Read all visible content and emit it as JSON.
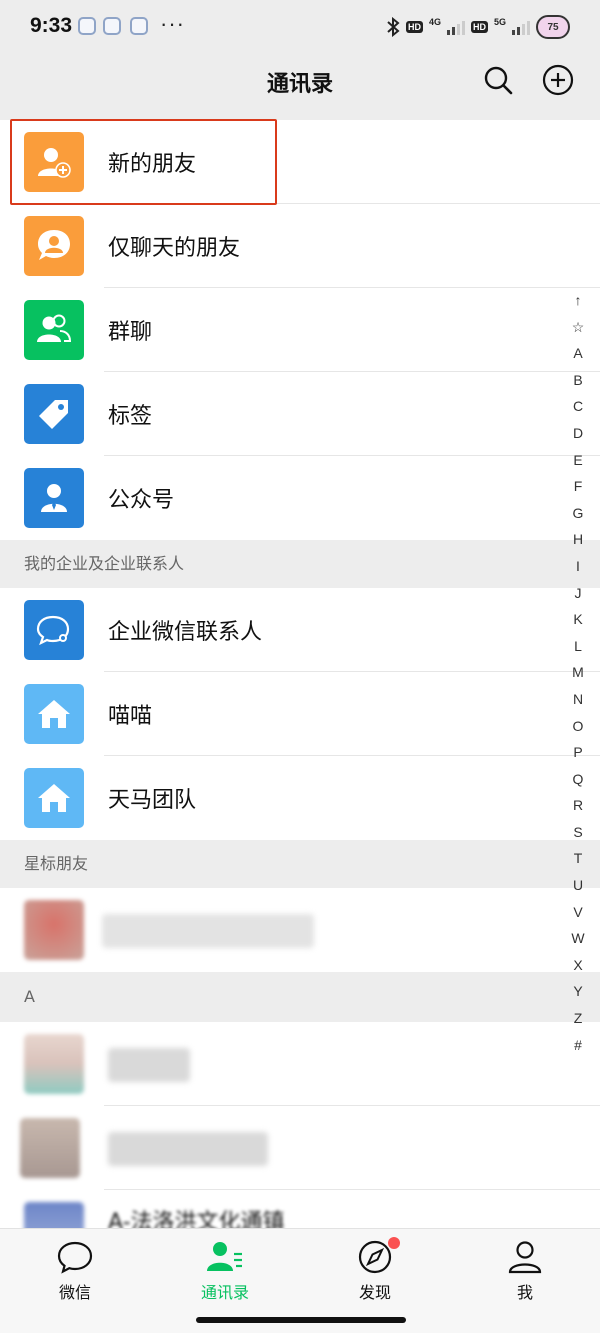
{
  "status_bar": {
    "time": "9:33",
    "dots": "···",
    "net1": "4G",
    "net2": "5G",
    "hd1": "HD",
    "hd2": "HD",
    "battery": "75"
  },
  "header": {
    "title": "通讯录",
    "search_icon": "search-icon",
    "add_icon": "plus-circle-icon"
  },
  "top_items": [
    {
      "label": "新的朋友",
      "icon": "add-friend-icon",
      "color": "#fa9d3b"
    },
    {
      "label": "仅聊天的朋友",
      "icon": "chat-only-icon",
      "color": "#fa9d3b"
    },
    {
      "label": "群聊",
      "icon": "group-icon",
      "color": "#07c160"
    },
    {
      "label": "标签",
      "icon": "tag-icon",
      "color": "#2782d7"
    },
    {
      "label": "公众号",
      "icon": "official-account-icon",
      "color": "#2782d7"
    }
  ],
  "enterprise": {
    "header": "我的企业及企业联系人",
    "items": [
      {
        "label": "企业微信联系人",
        "icon": "wecom-icon",
        "color": "#2782d7"
      },
      {
        "label": "喵喵",
        "icon": "house-icon",
        "color": "#5fb8f5"
      },
      {
        "label": "天马团队",
        "icon": "house-icon",
        "color": "#5fb8f5"
      }
    ]
  },
  "starred": {
    "header": "星标朋友"
  },
  "section_a": {
    "header": "A",
    "last_contact_name": "A-法洛洪文化通镇"
  },
  "index": [
    "↑",
    "☆",
    "A",
    "B",
    "C",
    "D",
    "E",
    "F",
    "G",
    "H",
    "I",
    "J",
    "K",
    "L",
    "M",
    "N",
    "O",
    "P",
    "Q",
    "R",
    "S",
    "T",
    "U",
    "V",
    "W",
    "X",
    "Y",
    "Z",
    "#"
  ],
  "tabs": [
    {
      "label": "微信",
      "icon": "chat-icon",
      "active": false
    },
    {
      "label": "通讯录",
      "icon": "contacts-icon",
      "active": true
    },
    {
      "label": "发现",
      "icon": "compass-icon",
      "active": false,
      "badge": true
    },
    {
      "label": "我",
      "icon": "person-icon",
      "active": false
    }
  ],
  "colors": {
    "accent": "#07c160",
    "highlight_border": "#d93a1b",
    "badge": "#fa5151"
  }
}
